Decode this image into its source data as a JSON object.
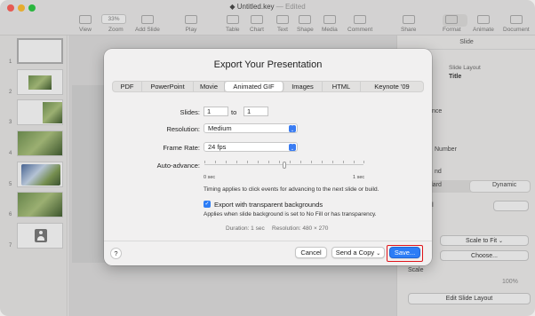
{
  "window": {
    "title": "Untitled.key",
    "edited": "— Edited",
    "toolbar": {
      "zoom_value": "33%",
      "items": [
        "View",
        "Zoom",
        "Add Slide",
        "Play",
        "Table",
        "Chart",
        "Text",
        "Shape",
        "Media",
        "Comment",
        "Share",
        "Format",
        "Animate",
        "Document"
      ]
    }
  },
  "navigator": {
    "slide_numbers": [
      "1",
      "2",
      "3",
      "4",
      "5",
      "6",
      "7"
    ]
  },
  "inspector": {
    "header": "Slide",
    "slide_layout_label": "Slide Layout",
    "slide_layout_value": "Title",
    "appearance_fragment": "nce",
    "number_fragment": "Number",
    "background_fragment": "nd",
    "seg_left": "ndard",
    "seg_right": "Dynamic",
    "fill_fragment": "ill",
    "scale_value": "Scale to Fit",
    "choose_label": "Choose...",
    "scale_label": "Scale",
    "scale_value_fragment": "100%",
    "edit_layout_label": "Edit Slide Layout"
  },
  "dialog": {
    "title": "Export Your Presentation",
    "tabs": [
      {
        "label": "PDF"
      },
      {
        "label": "PowerPoint"
      },
      {
        "label": "Movie"
      },
      {
        "label": "Animated GIF"
      },
      {
        "label": "Images"
      },
      {
        "label": "HTML"
      },
      {
        "label": "Keynote '09"
      }
    ],
    "active_tab": "Animated GIF",
    "slides_label": "Slides:",
    "slides_from": "1",
    "slides_to_label": "to",
    "slides_to": "1",
    "resolution_label": "Resolution:",
    "resolution_value": "Medium",
    "frame_rate_label": "Frame Rate:",
    "frame_rate_value": "24 fps",
    "auto_advance_label": "Auto-advance:",
    "auto_advance_min": "0 sec",
    "auto_advance_max": "1 sec",
    "auto_advance_position": 0.5,
    "timing_note": "Timing applies to click events for advancing to the next slide or build.",
    "transparent_checked": true,
    "transparent_label": "Export with transparent backgrounds",
    "transparent_note": "Applies when slide background is set to No Fill or has transparency.",
    "duration_text": "Duration: 1 sec",
    "resolution_text": "Resolution: 480 × 270",
    "help_label": "?",
    "cancel_label": "Cancel",
    "send_copy_label": "Send a Copy",
    "save_label": "Save..."
  },
  "colors": {
    "accent": "#2d7df6",
    "highlight_ring": "#e0141a"
  }
}
